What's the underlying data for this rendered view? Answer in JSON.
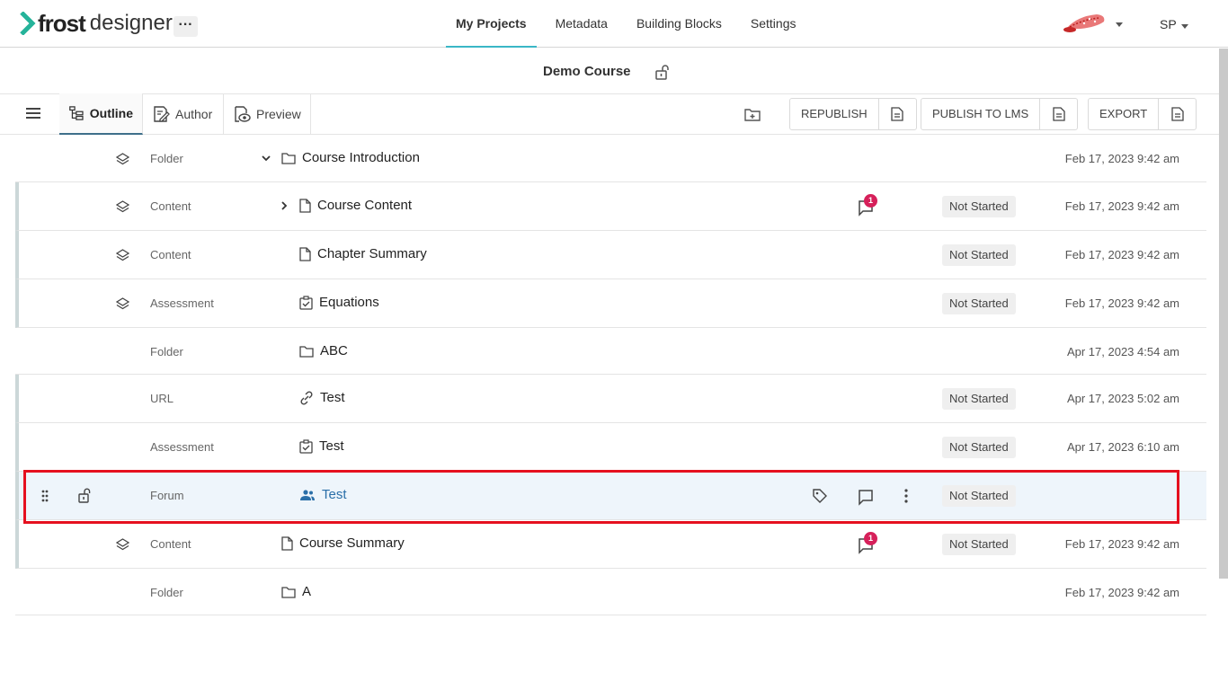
{
  "brand": {
    "frost": "frost",
    "designer": "designer",
    "more": "···"
  },
  "nav": {
    "items": [
      "My Projects",
      "Metadata",
      "Building Blocks",
      "Settings"
    ],
    "active": "My Projects"
  },
  "user": {
    "initials": "SP"
  },
  "course": {
    "title": "Demo Course"
  },
  "toolbar": {
    "tabs": [
      "Outline",
      "Author",
      "Preview"
    ],
    "active_tab": "Outline",
    "republish": "REPUBLISH",
    "publish_lms": "PUBLISH TO LMS",
    "export": "EXPORT"
  },
  "rows": [
    {
      "type": "Folder",
      "name": "Course Introduction",
      "icon": "folder-icon",
      "expander": "chevron-down-icon",
      "status": "",
      "date": "Feb 17, 2023 9:42 am",
      "comments": ""
    },
    {
      "type": "Content",
      "name": "Course Content",
      "icon": "document-icon",
      "expander": "chevron-right-icon",
      "status": "Not Started",
      "date": "Feb 17, 2023 9:42 am",
      "comments": "1"
    },
    {
      "type": "Content",
      "name": "Chapter Summary",
      "icon": "document-icon",
      "status": "Not Started",
      "date": "Feb 17, 2023 9:42 am",
      "comments": ""
    },
    {
      "type": "Assessment",
      "name": "Equations",
      "icon": "checklist-icon",
      "status": "Not Started",
      "date": "Feb 17, 2023 9:42 am",
      "comments": ""
    },
    {
      "type": "Folder",
      "name": "ABC",
      "icon": "folder-icon",
      "status": "",
      "date": "Apr 17, 2023 4:54 am",
      "comments": ""
    },
    {
      "type": "URL",
      "name": "Test",
      "icon": "link-icon",
      "status": "Not Started",
      "date": "Apr 17, 2023 5:02 am",
      "comments": ""
    },
    {
      "type": "Assessment",
      "name": "Test",
      "icon": "checklist-icon",
      "status": "Not Started",
      "date": "Apr 17, 2023 6:10 am",
      "comments": ""
    },
    {
      "type": "Forum",
      "name": "Test",
      "icon": "people-icon",
      "status": "Not Started",
      "date": "",
      "comments": ""
    },
    {
      "type": "Content",
      "name": "Course Summary",
      "icon": "document-icon",
      "status": "Not Started",
      "date": "Feb 17, 2023 9:42 am",
      "comments": "1"
    },
    {
      "type": "Folder",
      "name": "A",
      "icon": "folder-icon",
      "status": "",
      "date": "Feb 17, 2023 9:42 am",
      "comments": ""
    }
  ],
  "colors": {
    "accent": "#3ab7c6",
    "badge": "#d6205a",
    "highlight_outline": "#e5101f",
    "link": "#2a6fa8"
  }
}
